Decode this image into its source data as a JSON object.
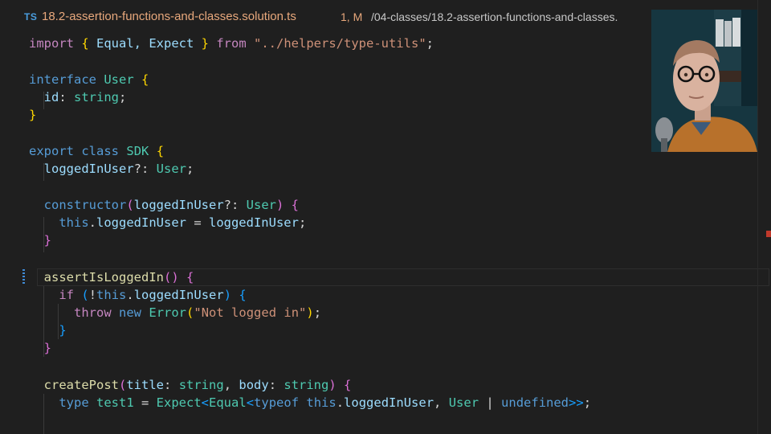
{
  "tab": {
    "icon_label": "TS",
    "filename": "18.2-assertion-functions-and-classes.solution.ts",
    "status": "1, M",
    "path": "/04-classes/18.2-assertion-functions-and-classes."
  },
  "code": {
    "l1": [
      "import",
      " ",
      "{",
      " Equal, Expect ",
      "}",
      " from ",
      "\"../helpers/type-utils\"",
      ";"
    ],
    "l3": [
      "interface",
      " ",
      "User",
      " ",
      "{"
    ],
    "l4": [
      "  ",
      "id",
      ": ",
      "string",
      ";"
    ],
    "l5": [
      "}"
    ],
    "l7": [
      "export",
      " ",
      "class",
      " ",
      "SDK",
      " ",
      "{"
    ],
    "l8": [
      "  ",
      "loggedInUser",
      "?: ",
      "User",
      ";"
    ],
    "l10": [
      "  ",
      "constructor",
      "(",
      "loggedInUser",
      "?: ",
      "User",
      ")",
      " ",
      "{"
    ],
    "l11": [
      "    ",
      "this",
      ".",
      "loggedInUser",
      " = ",
      "loggedInUser",
      ";"
    ],
    "l12": [
      "  ",
      "}"
    ],
    "l14": [
      "  ",
      "assertIsLoggedIn",
      "()",
      " ",
      "{"
    ],
    "l15": [
      "    ",
      "if",
      " ",
      "(",
      "!",
      "this",
      ".",
      "loggedInUser",
      ")",
      " ",
      "{"
    ],
    "l16": [
      "      ",
      "throw",
      " ",
      "new",
      " ",
      "Error",
      "(",
      "\"Not logged in\"",
      ")",
      ";"
    ],
    "l17": [
      "    ",
      "}"
    ],
    "l18": [
      "  ",
      "}"
    ],
    "l20": [
      "  ",
      "createPost",
      "(",
      "title",
      ": ",
      "string",
      ", ",
      "body",
      ": ",
      "string",
      ")",
      " ",
      "{"
    ],
    "l21": [
      "    ",
      "type",
      " ",
      "test1",
      " = ",
      "Expect",
      "<",
      "Equal",
      "<",
      "typeof",
      " ",
      "this",
      ".",
      "loggedInUser",
      ", ",
      "User",
      " | ",
      "undefined",
      ">>",
      ";"
    ]
  },
  "colors": {
    "background": "#1f1f1f",
    "keyword": "#569cd6",
    "control": "#c586c0",
    "variable": "#9cdcfe",
    "type": "#4ec9b0",
    "function": "#dcdcaa",
    "string": "#ce9178",
    "modified_tab": "#e8a87c"
  },
  "webcam": {
    "label": "presenter-webcam"
  }
}
